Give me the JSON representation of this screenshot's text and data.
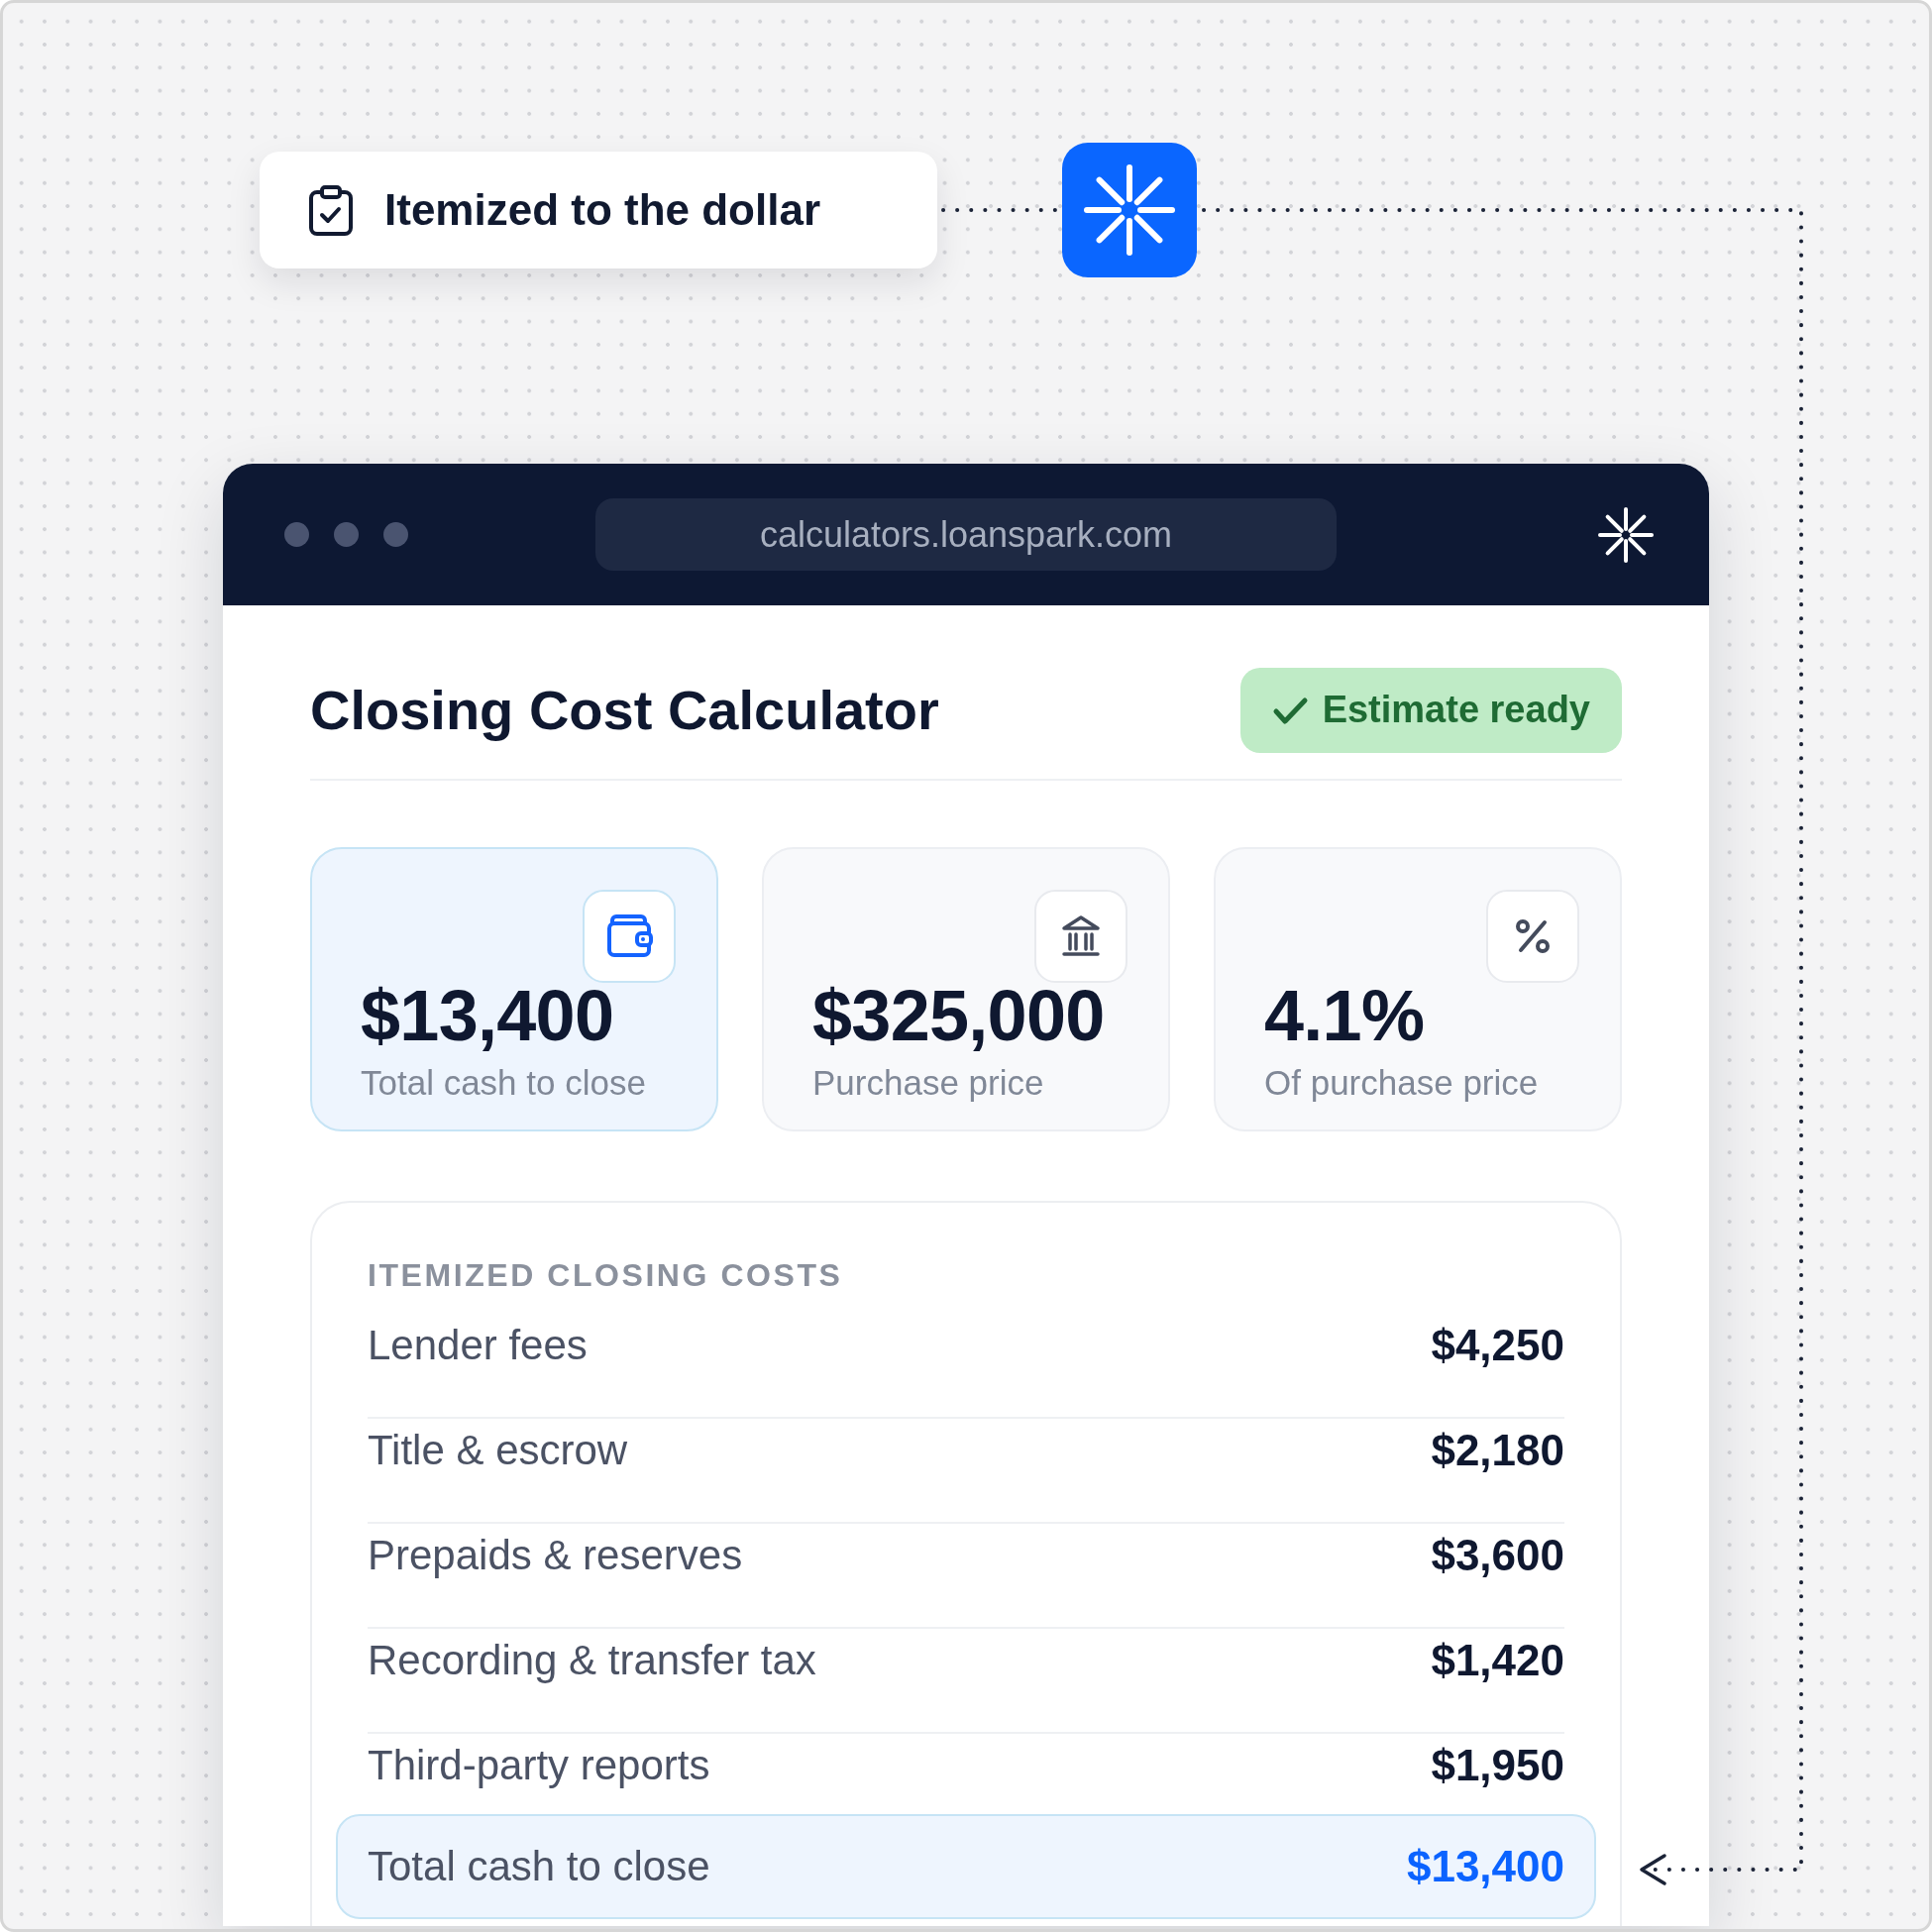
{
  "callout": {
    "text": "Itemized to the dollar"
  },
  "browser": {
    "url": "calculators.loanspark.com"
  },
  "page": {
    "title": "Closing Cost Calculator",
    "status_badge": {
      "text": "Estimate ready"
    }
  },
  "stat_cards": [
    {
      "value": "$13,400",
      "label": "Total cash to close",
      "highlighted": true
    },
    {
      "value": "$325,000",
      "label": "Purchase price",
      "highlighted": false
    },
    {
      "value": "4.1%",
      "label": "Of purchase price",
      "highlighted": false
    }
  ],
  "cost_breakdown": {
    "heading": "ITEMIZED CLOSING COSTS",
    "rows": [
      {
        "label": "Lender fees",
        "amount": "$4,250"
      },
      {
        "label": "Title & escrow",
        "amount": "$2,180"
      },
      {
        "label": "Prepaids & reserves",
        "amount": "$3,600"
      },
      {
        "label": "Recording & transfer tax",
        "amount": "$1,420"
      },
      {
        "label": "Third-party reports",
        "amount": "$1,950"
      }
    ],
    "total": {
      "label": "Total cash to close",
      "amount": "$13,400"
    }
  }
}
